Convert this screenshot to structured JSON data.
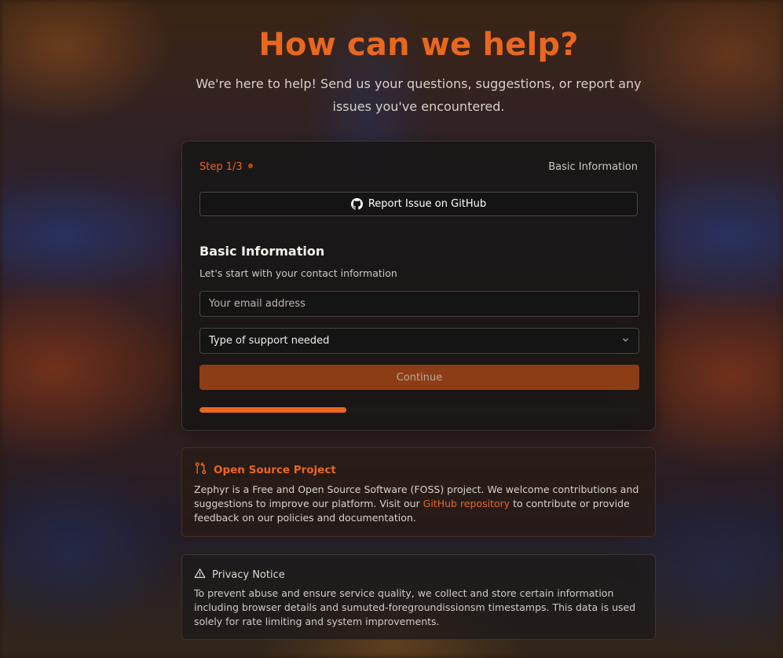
{
  "header": {
    "title": "How can we help?",
    "subtitle": "We're here to help! Send us your questions, suggestions, or report any issues you've encountered."
  },
  "form": {
    "step_label": "Step 1/3",
    "step_name": "Basic Information",
    "github_button_label": "Report Issue on GitHub",
    "section_title": "Basic Information",
    "section_description": "Let's start with your contact information",
    "email_placeholder": "Your email address",
    "support_type_value": "Type of support needed",
    "continue_label": "Continue",
    "progress_fraction": 0.3333
  },
  "oss_notice": {
    "title": "Open Source Project",
    "text_before": "Zephyr is a Free and Open Source Software (FOSS) project. We welcome contributions and suggestions to improve our platform. Visit our ",
    "link_text": "GitHub repository",
    "text_after": " to contribute or provide feedback on our policies and documentation."
  },
  "privacy_notice": {
    "title": "Privacy Notice",
    "text": "To prevent abuse and ensure service quality, we collect and store certain information including browser details and sumuted-foregroundissionsm timestamps. This data is used solely for rate limiting and system improvements."
  },
  "icons": {
    "github": "github-icon",
    "pull_request": "git-pull-request-icon",
    "warning": "warning-triangle-icon",
    "chevron": "chevron-down-icon"
  },
  "colors": {
    "accent": "#e9671f",
    "button_disabled": "#8d3d16"
  }
}
